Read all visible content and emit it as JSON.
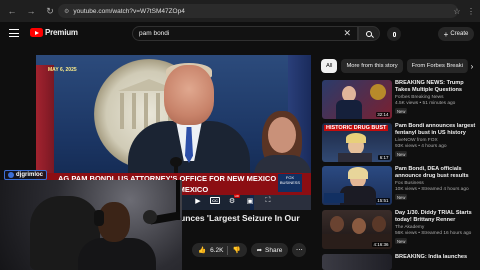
{
  "browser": {
    "url": "youtube.com/watch?v=W7tSM47ZOp4",
    "back_icon": "arrow-left-icon",
    "forward_icon": "arrow-right-icon",
    "reload_icon": "reload-icon"
  },
  "header": {
    "logo_text": "Premium",
    "search_value": "pam bondi",
    "create_label": "Create",
    "colors": {
      "brand": "#ff0000",
      "background": "#0f0f0f"
    }
  },
  "player": {
    "lower_third_line1": "AG PAM BONDI, US ATTORNEY'S OFFICE FOR NEW MEXICO",
    "lower_third_line2": "NEW MEXICO",
    "corner_text": "MAY 6, 2025",
    "network_bug": "FOX BUSINESS"
  },
  "streamer": {
    "name": "djgrimloc"
  },
  "video": {
    "title": "unces 'Largest Seizure In Our",
    "likes": "6.2K",
    "share_label": "Share"
  },
  "chips": [
    {
      "label": "All",
      "active": true
    },
    {
      "label": "More from this story",
      "active": false
    },
    {
      "label": "From Forbes Breaki",
      "active": false
    }
  ],
  "recommendations": [
    {
      "title": "BREAKING NEWS: Trump Takes Multiple Questions From...",
      "channel": "Forbes Breaking News",
      "meta": "4.5K views • 51 minutes ago",
      "badge": "New",
      "duration": "32:14",
      "thumb_label": ""
    },
    {
      "title": "Pam Bondi announces largest fentanyl bust in US history",
      "channel": "LiveNOW from FOX",
      "meta": "93K views • 4 hours ago",
      "badge": "New",
      "duration": "6:17",
      "thumb_label": "HISTORIC DRUG BUST"
    },
    {
      "title": "Pam Bondi, DEA officials announce drug bust results",
      "channel": "Fox Business",
      "meta": "10K views • Streamed 4 hours ago",
      "badge": "New",
      "duration": "15:51",
      "thumb_label": ""
    },
    {
      "title": "Day 1/30. Diddy TRIAL Starts today! Brittany Renner marries...",
      "channel": "The Akademy",
      "meta": "56K views • Streamed 16 hours ago",
      "badge": "New",
      "duration": "4:16:36",
      "thumb_label": ""
    },
    {
      "title": "BREAKING: India launches",
      "channel": "",
      "meta": "",
      "badge": "",
      "duration": "",
      "thumb_label": ""
    }
  ]
}
